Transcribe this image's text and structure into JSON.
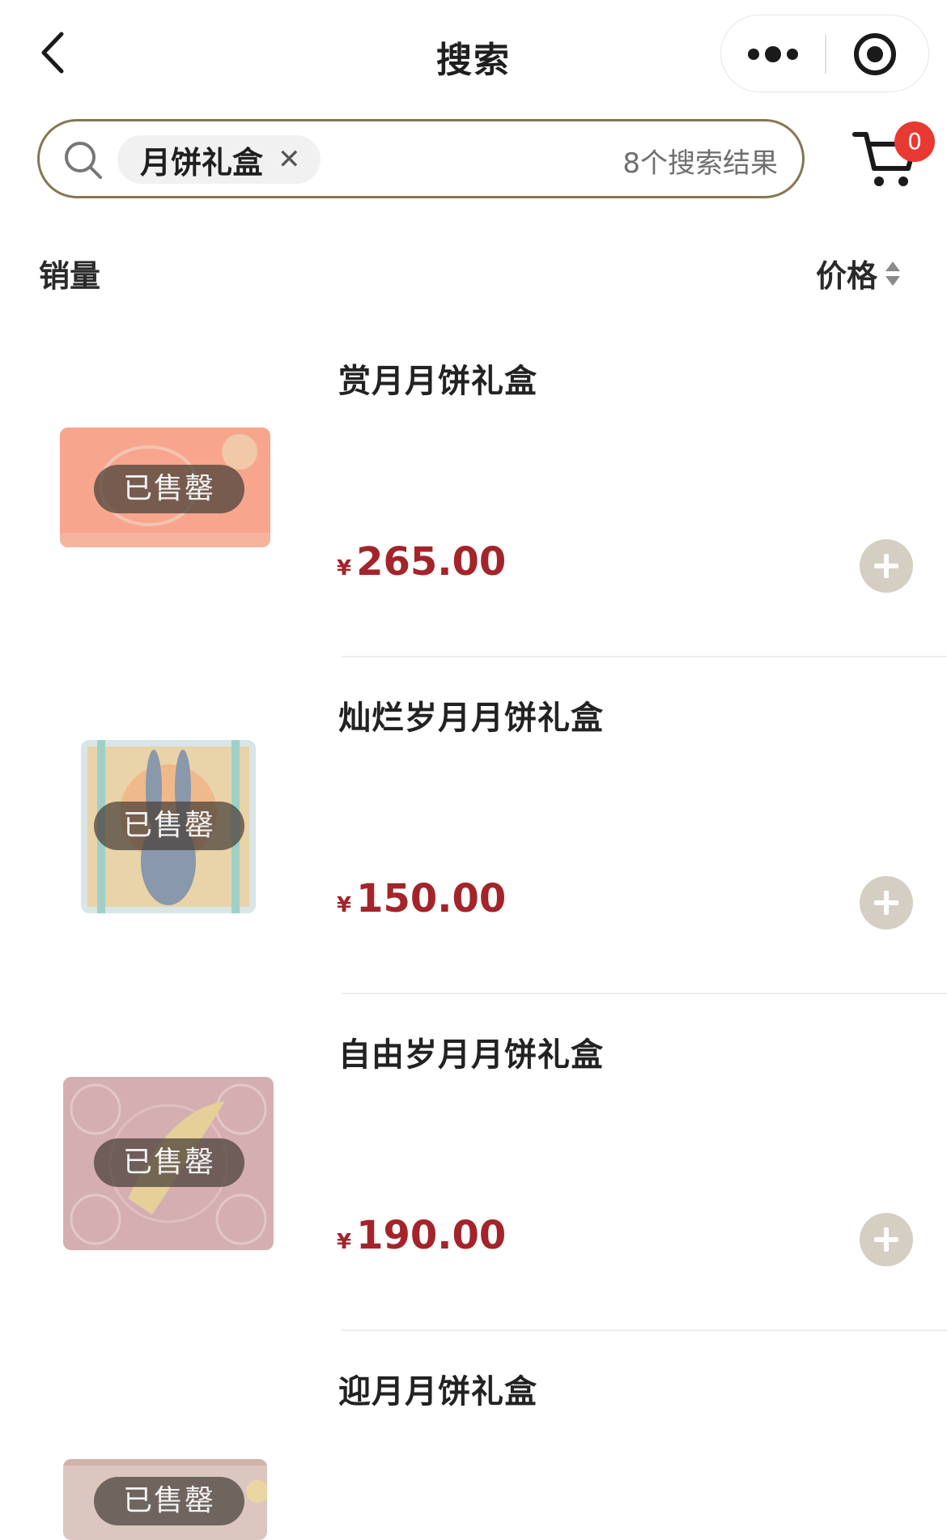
{
  "nav": {
    "title": "搜索"
  },
  "search": {
    "query": "月饼礼盒",
    "result_count": "8个搜索结果"
  },
  "cart": {
    "count": "0"
  },
  "sort": {
    "sales": "销量",
    "price": "价格"
  },
  "products": [
    {
      "name": "赏月月饼礼盒",
      "currency": "¥",
      "price": "265.00",
      "status": "已售罄"
    },
    {
      "name": "灿烂岁月月饼礼盒",
      "currency": "¥",
      "price": "150.00",
      "status": "已售罄"
    },
    {
      "name": "自由岁月月饼礼盒",
      "currency": "¥",
      "price": "190.00",
      "status": "已售罄"
    },
    {
      "name": "迎月月饼礼盒",
      "status": "已售罄"
    }
  ],
  "colors": {
    "price": "#a3242a",
    "search_border": "#857654",
    "badge": "#e83a33",
    "add_button": "#d5cfc3"
  }
}
